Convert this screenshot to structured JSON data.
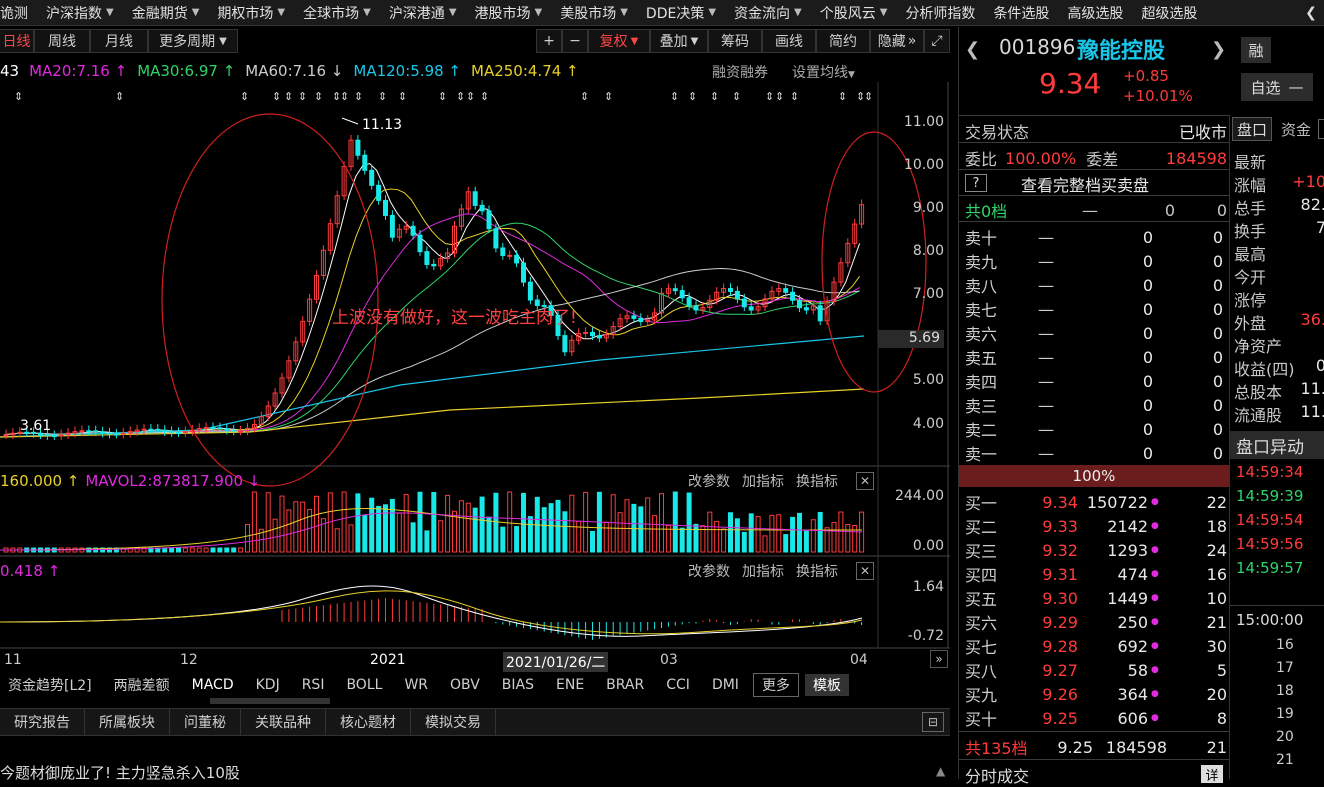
{
  "topnav": {
    "items": [
      {
        "label": "诡测",
        "arrow": false
      },
      {
        "label": "沪深指数",
        "arrow": true
      },
      {
        "label": "金融期货",
        "arrow": true
      },
      {
        "label": "期权市场",
        "arrow": true
      },
      {
        "label": "全球市场",
        "arrow": true
      },
      {
        "label": "沪深港通",
        "arrow": true
      },
      {
        "label": "港股市场",
        "arrow": true
      },
      {
        "label": "美股市场",
        "arrow": true
      },
      {
        "label": "DDE决策",
        "arrow": true
      },
      {
        "label": "资金流向",
        "arrow": true
      },
      {
        "label": "个股风云",
        "arrow": true
      },
      {
        "label": "分析师指数",
        "arrow": false
      },
      {
        "label": "条件选股",
        "arrow": false
      },
      {
        "label": "高级选股",
        "arrow": false
      },
      {
        "label": "超级选股",
        "arrow": false
      }
    ],
    "back_icon": "back-arrow-icon"
  },
  "period_tabs": [
    "日线",
    "周线",
    "月线",
    "更多周期"
  ],
  "toolbar": {
    "plus": "+",
    "minus": "−",
    "fuquan": "复权",
    "diejia": "叠加",
    "chouma": "筹码",
    "huaxian": "画线",
    "jianyue": "简约",
    "yincang": "隐藏"
  },
  "ma_legend": [
    {
      "text": "43",
      "color": "#ffffff"
    },
    {
      "text": "MA20:7.16 ↑",
      "color": "#e02ae0"
    },
    {
      "text": "MA30:6.97 ↑",
      "color": "#2fd36a"
    },
    {
      "text": "MA60:7.16 ↓",
      "color": "#cccccc"
    },
    {
      "text": "MA120:5.98 ↑",
      "color": "#19c6e8"
    },
    {
      "text": "MA250:4.74 ↑",
      "color": "#e8d02a"
    }
  ],
  "ma_links": {
    "rongzi": "融资融券",
    "shezhi": "设置均线"
  },
  "price_axis": [
    "11.00",
    "10.00",
    "9.00",
    "8.00",
    "7.00",
    "6.00",
    "5.00",
    "4.00"
  ],
  "current_price_tag": "5.69",
  "high_label": "11.13",
  "low_label": "3.61",
  "annotation": "上波没有做好，这一波吃主肉了!",
  "vol_legend": [
    {
      "text": "160.000 ↑",
      "color": "#e8d02a"
    },
    {
      "text": "MAVOL2:873817.900 ↓",
      "color": "#e02ae0"
    }
  ],
  "panel_links": {
    "gaicanshu": "改参数",
    "jiazhibiao": "加指标",
    "huanzhibiao": "换指标"
  },
  "vol_axis": [
    "244.00",
    "0.00"
  ],
  "macd_legend": {
    "text": "0.418 ↑",
    "color": "#e02ae0"
  },
  "macd_axis": [
    "1.64",
    "-0.72"
  ],
  "date_axis": [
    "11",
    "12",
    "2021",
    "2021/01/26/二",
    "03",
    "04"
  ],
  "indicator_tabs": [
    "资金趋势[L2]",
    "两融差额",
    "MACD",
    "KDJ",
    "RSI",
    "BOLL",
    "WR",
    "OBV",
    "BIAS",
    "ENE",
    "BRAR",
    "CCI",
    "DMI",
    "更多",
    "模板"
  ],
  "bottom_tabs": [
    "研究报告",
    "所属板块",
    "问董秘",
    "关联品种",
    "核心题材",
    "模拟交易"
  ],
  "news_ticker": "今题材御庞业了! 主力竖急杀入10股",
  "stock": {
    "code": "001896",
    "name": "豫能控股",
    "price": "9.34",
    "change": "+0.85",
    "change_pct": "+10.01%",
    "rong": "融",
    "zixuan": "自选"
  },
  "order_book": {
    "status_label": "交易状态",
    "status_value": "已收市",
    "weibi_label": "委比",
    "weibi_value": "100.00%",
    "weicha_label": "委差",
    "weicha_value": "184598",
    "help": "?",
    "full_book": "查看完整档买卖盘",
    "sell_total": {
      "label": "共0档",
      "dash": "—",
      "v1": "0",
      "v2": "0"
    },
    "sells": [
      {
        "label": "卖十",
        "price": "—",
        "vol": "0",
        "n": "0"
      },
      {
        "label": "卖九",
        "price": "—",
        "vol": "0",
        "n": "0"
      },
      {
        "label": "卖八",
        "price": "—",
        "vol": "0",
        "n": "0"
      },
      {
        "label": "卖七",
        "price": "—",
        "vol": "0",
        "n": "0"
      },
      {
        "label": "卖六",
        "price": "—",
        "vol": "0",
        "n": "0"
      },
      {
        "label": "卖五",
        "price": "—",
        "vol": "0",
        "n": "0"
      },
      {
        "label": "卖四",
        "price": "—",
        "vol": "0",
        "n": "0"
      },
      {
        "label": "卖三",
        "price": "—",
        "vol": "0",
        "n": "0"
      },
      {
        "label": "卖二",
        "price": "—",
        "vol": "0",
        "n": "0"
      },
      {
        "label": "卖一",
        "price": "—",
        "vol": "0",
        "n": "0"
      }
    ],
    "ratio": "100%",
    "buys": [
      {
        "label": "买一",
        "price": "9.34",
        "vol": "150722",
        "n": "22"
      },
      {
        "label": "买二",
        "price": "9.33",
        "vol": "2142",
        "n": "18"
      },
      {
        "label": "买三",
        "price": "9.32",
        "vol": "1293",
        "n": "24"
      },
      {
        "label": "买四",
        "price": "9.31",
        "vol": "474",
        "n": "16"
      },
      {
        "label": "买五",
        "price": "9.30",
        "vol": "1449",
        "n": "10"
      },
      {
        "label": "买六",
        "price": "9.29",
        "vol": "250",
        "n": "21"
      },
      {
        "label": "买七",
        "price": "9.28",
        "vol": "692",
        "n": "30"
      },
      {
        "label": "买八",
        "price": "9.27",
        "vol": "58",
        "n": "5"
      },
      {
        "label": "买九",
        "price": "9.26",
        "vol": "364",
        "n": "20"
      },
      {
        "label": "买十",
        "price": "9.25",
        "vol": "606",
        "n": "8"
      }
    ],
    "buy_total": {
      "label": "共135档",
      "price": "9.25",
      "vol": "184598",
      "n": "21"
    },
    "fenshi": "分时成交",
    "xiang": "详"
  },
  "side_tabs": [
    "盘口",
    "资金"
  ],
  "side_stats": [
    {
      "label": "最新",
      "value": ""
    },
    {
      "label": "涨幅",
      "value": "+10"
    },
    {
      "label": "总手",
      "value": "82."
    },
    {
      "label": "换手",
      "value": "7"
    },
    {
      "label": "最高",
      "value": ""
    },
    {
      "label": "今开",
      "value": ""
    },
    {
      "label": "涨停",
      "value": ""
    },
    {
      "label": "外盘",
      "value": "36."
    },
    {
      "label": "净资产",
      "value": ""
    },
    {
      "label": "收益(四)",
      "value": "0"
    },
    {
      "label": "总股本",
      "value": "11."
    },
    {
      "label": "流通股",
      "value": "11."
    }
  ],
  "pankou_title": "盘口异动",
  "pankou_times": [
    {
      "time": "14:59:34",
      "color": "#ff3b3b"
    },
    {
      "time": "14:59:39",
      "color": "#2fd36a"
    },
    {
      "time": "14:59:54",
      "color": "#ff3b3b"
    },
    {
      "time": "14:59:56",
      "color": "#ff3b3b"
    },
    {
      "time": "14:59:57",
      "color": "#2fd36a"
    }
  ],
  "timeline_head": "15:00:00",
  "timeline_nums": [
    "16",
    "17",
    "18",
    "19",
    "20",
    "21"
  ]
}
